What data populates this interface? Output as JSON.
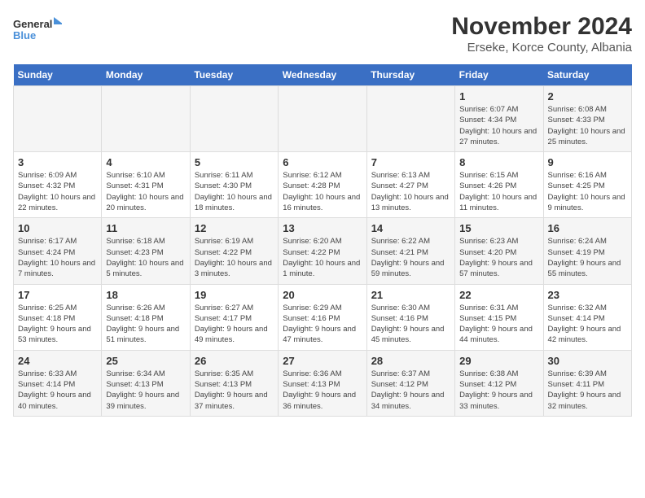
{
  "logo": {
    "general": "General",
    "blue": "Blue"
  },
  "title": "November 2024",
  "subtitle": "Erseke, Korce County, Albania",
  "days_header": [
    "Sunday",
    "Monday",
    "Tuesday",
    "Wednesday",
    "Thursday",
    "Friday",
    "Saturday"
  ],
  "weeks": [
    [
      {
        "day": "",
        "info": ""
      },
      {
        "day": "",
        "info": ""
      },
      {
        "day": "",
        "info": ""
      },
      {
        "day": "",
        "info": ""
      },
      {
        "day": "",
        "info": ""
      },
      {
        "day": "1",
        "info": "Sunrise: 6:07 AM\nSunset: 4:34 PM\nDaylight: 10 hours and 27 minutes."
      },
      {
        "day": "2",
        "info": "Sunrise: 6:08 AM\nSunset: 4:33 PM\nDaylight: 10 hours and 25 minutes."
      }
    ],
    [
      {
        "day": "3",
        "info": "Sunrise: 6:09 AM\nSunset: 4:32 PM\nDaylight: 10 hours and 22 minutes."
      },
      {
        "day": "4",
        "info": "Sunrise: 6:10 AM\nSunset: 4:31 PM\nDaylight: 10 hours and 20 minutes."
      },
      {
        "day": "5",
        "info": "Sunrise: 6:11 AM\nSunset: 4:30 PM\nDaylight: 10 hours and 18 minutes."
      },
      {
        "day": "6",
        "info": "Sunrise: 6:12 AM\nSunset: 4:28 PM\nDaylight: 10 hours and 16 minutes."
      },
      {
        "day": "7",
        "info": "Sunrise: 6:13 AM\nSunset: 4:27 PM\nDaylight: 10 hours and 13 minutes."
      },
      {
        "day": "8",
        "info": "Sunrise: 6:15 AM\nSunset: 4:26 PM\nDaylight: 10 hours and 11 minutes."
      },
      {
        "day": "9",
        "info": "Sunrise: 6:16 AM\nSunset: 4:25 PM\nDaylight: 10 hours and 9 minutes."
      }
    ],
    [
      {
        "day": "10",
        "info": "Sunrise: 6:17 AM\nSunset: 4:24 PM\nDaylight: 10 hours and 7 minutes."
      },
      {
        "day": "11",
        "info": "Sunrise: 6:18 AM\nSunset: 4:23 PM\nDaylight: 10 hours and 5 minutes."
      },
      {
        "day": "12",
        "info": "Sunrise: 6:19 AM\nSunset: 4:22 PM\nDaylight: 10 hours and 3 minutes."
      },
      {
        "day": "13",
        "info": "Sunrise: 6:20 AM\nSunset: 4:22 PM\nDaylight: 10 hours and 1 minute."
      },
      {
        "day": "14",
        "info": "Sunrise: 6:22 AM\nSunset: 4:21 PM\nDaylight: 9 hours and 59 minutes."
      },
      {
        "day": "15",
        "info": "Sunrise: 6:23 AM\nSunset: 4:20 PM\nDaylight: 9 hours and 57 minutes."
      },
      {
        "day": "16",
        "info": "Sunrise: 6:24 AM\nSunset: 4:19 PM\nDaylight: 9 hours and 55 minutes."
      }
    ],
    [
      {
        "day": "17",
        "info": "Sunrise: 6:25 AM\nSunset: 4:18 PM\nDaylight: 9 hours and 53 minutes."
      },
      {
        "day": "18",
        "info": "Sunrise: 6:26 AM\nSunset: 4:18 PM\nDaylight: 9 hours and 51 minutes."
      },
      {
        "day": "19",
        "info": "Sunrise: 6:27 AM\nSunset: 4:17 PM\nDaylight: 9 hours and 49 minutes."
      },
      {
        "day": "20",
        "info": "Sunrise: 6:29 AM\nSunset: 4:16 PM\nDaylight: 9 hours and 47 minutes."
      },
      {
        "day": "21",
        "info": "Sunrise: 6:30 AM\nSunset: 4:16 PM\nDaylight: 9 hours and 45 minutes."
      },
      {
        "day": "22",
        "info": "Sunrise: 6:31 AM\nSunset: 4:15 PM\nDaylight: 9 hours and 44 minutes."
      },
      {
        "day": "23",
        "info": "Sunrise: 6:32 AM\nSunset: 4:14 PM\nDaylight: 9 hours and 42 minutes."
      }
    ],
    [
      {
        "day": "24",
        "info": "Sunrise: 6:33 AM\nSunset: 4:14 PM\nDaylight: 9 hours and 40 minutes."
      },
      {
        "day": "25",
        "info": "Sunrise: 6:34 AM\nSunset: 4:13 PM\nDaylight: 9 hours and 39 minutes."
      },
      {
        "day": "26",
        "info": "Sunrise: 6:35 AM\nSunset: 4:13 PM\nDaylight: 9 hours and 37 minutes."
      },
      {
        "day": "27",
        "info": "Sunrise: 6:36 AM\nSunset: 4:13 PM\nDaylight: 9 hours and 36 minutes."
      },
      {
        "day": "28",
        "info": "Sunrise: 6:37 AM\nSunset: 4:12 PM\nDaylight: 9 hours and 34 minutes."
      },
      {
        "day": "29",
        "info": "Sunrise: 6:38 AM\nSunset: 4:12 PM\nDaylight: 9 hours and 33 minutes."
      },
      {
        "day": "30",
        "info": "Sunrise: 6:39 AM\nSunset: 4:11 PM\nDaylight: 9 hours and 32 minutes."
      }
    ]
  ]
}
